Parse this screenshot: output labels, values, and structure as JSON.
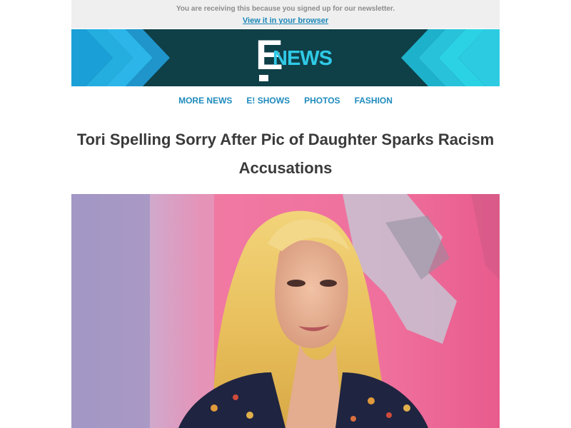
{
  "preheader": {
    "note": "You are receiving this because you signed up for our newsletter.",
    "view_in_browser": "View it in your browser"
  },
  "logo": {
    "letter": "E",
    "word": "NEWS"
  },
  "nav": {
    "items": [
      {
        "label": "MORE NEWS"
      },
      {
        "label": "E! SHOWS"
      },
      {
        "label": "PHOTOS"
      },
      {
        "label": "FASHION"
      }
    ]
  },
  "article": {
    "headline": "Tori Spelling Sorry After Pic of Daughter Sparks Racism Accusations"
  },
  "colors": {
    "banner_bg": "#0f3f47",
    "chevron_left": "#1a9fd6",
    "chevron_right": "#2ccbe2",
    "link": "#1f8bbd",
    "headline": "#3a3a3a"
  },
  "icons": [
    "chevron-right-icon",
    "chevron-left-icon",
    "e-news-logo-icon"
  ]
}
